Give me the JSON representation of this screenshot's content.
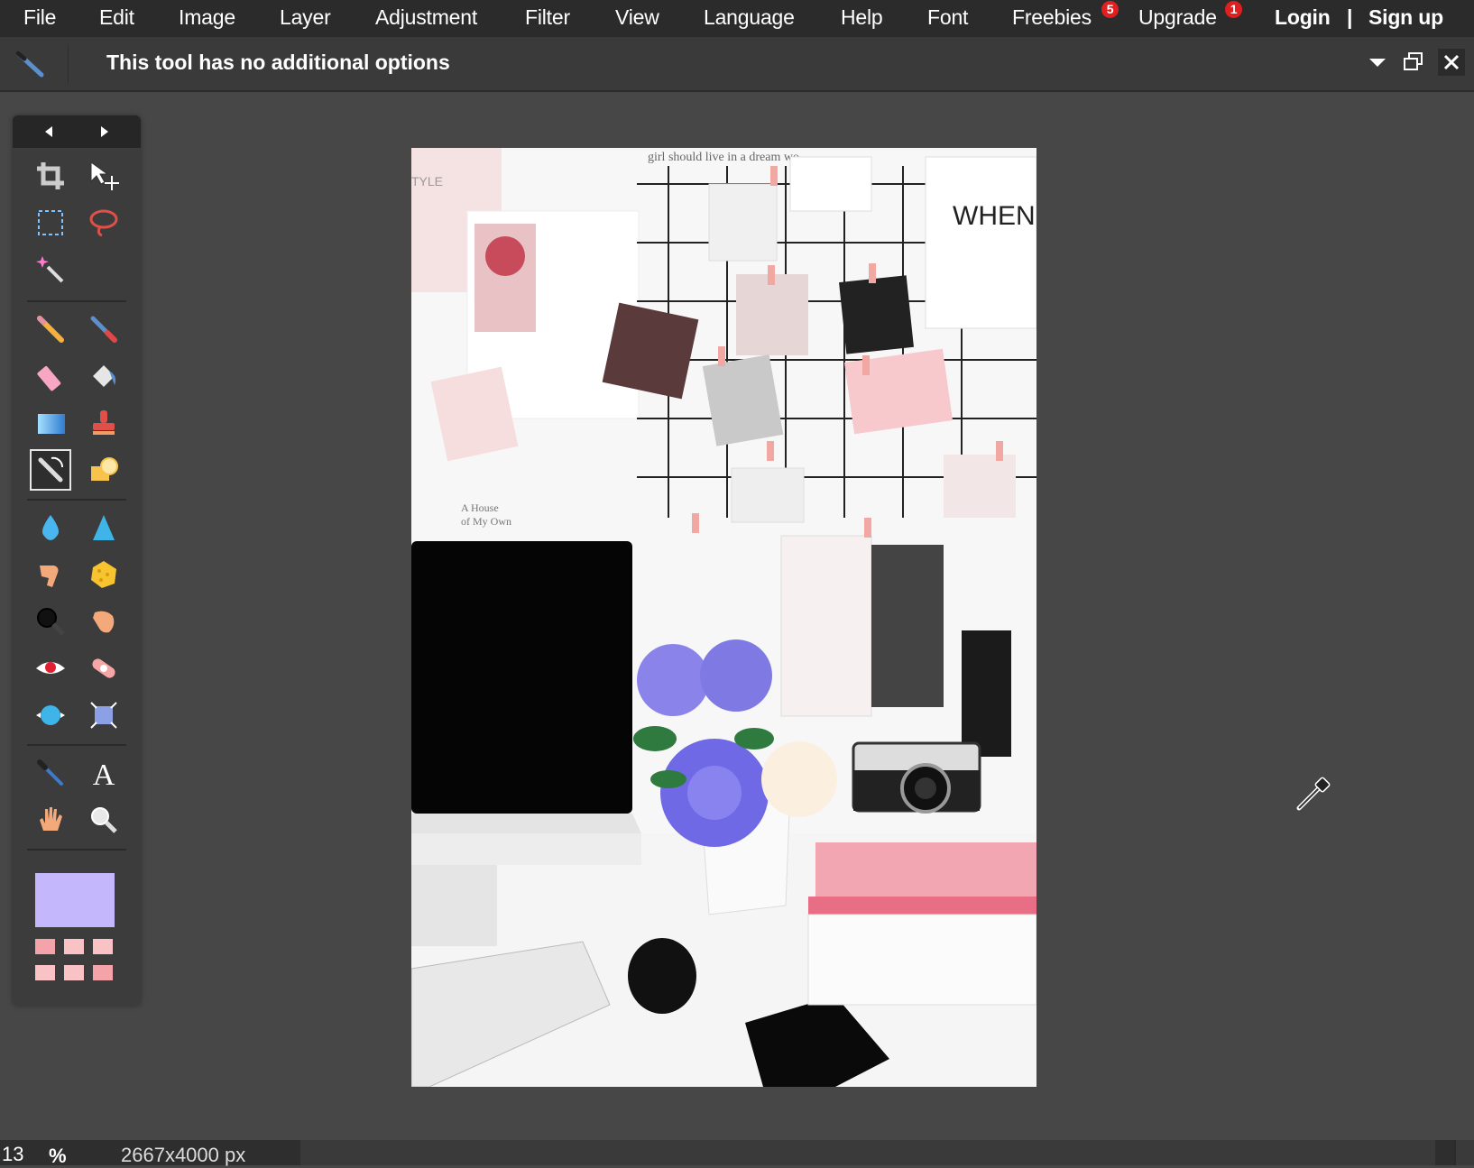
{
  "menu": {
    "items": [
      "File",
      "Edit",
      "Image",
      "Layer",
      "Adjustment",
      "Filter",
      "View",
      "Language",
      "Help",
      "Font",
      "Freebies",
      "Upgrade"
    ],
    "freebies_badge": "5",
    "upgrade_badge": "1",
    "login": "Login",
    "separator": "|",
    "signup": "Sign up"
  },
  "options": {
    "message": "This tool has no additional options"
  },
  "toolbox": {
    "active_tool": "replace-color",
    "tools": [
      "crop",
      "move",
      "marquee",
      "lasso",
      "wand",
      "pencil",
      "brush",
      "eraser",
      "bucket",
      "gradient",
      "clone-stamp",
      "replace-color",
      "draw",
      "blur",
      "sharpen",
      "smudge",
      "sponge",
      "dodge",
      "burn",
      "red-eye",
      "spot-heal",
      "bloat",
      "pinch",
      "color-picker",
      "type",
      "hand",
      "zoom"
    ],
    "primary_color": "#c4b7fc",
    "swatches": [
      "#f4a3a8",
      "#f9c3c6",
      "#f9c3c6",
      "#f9c3c6",
      "#f9c3c6",
      "#f4a3a8"
    ]
  },
  "canvas": {
    "text_when": "WHEN",
    "text_house": "A House",
    "text_own": "of My Own",
    "text_style": "TYLE",
    "text_dream": "girl should live in a dream wo"
  },
  "status": {
    "zoom": "13",
    "percent": "%",
    "size": "2667x4000 px"
  }
}
